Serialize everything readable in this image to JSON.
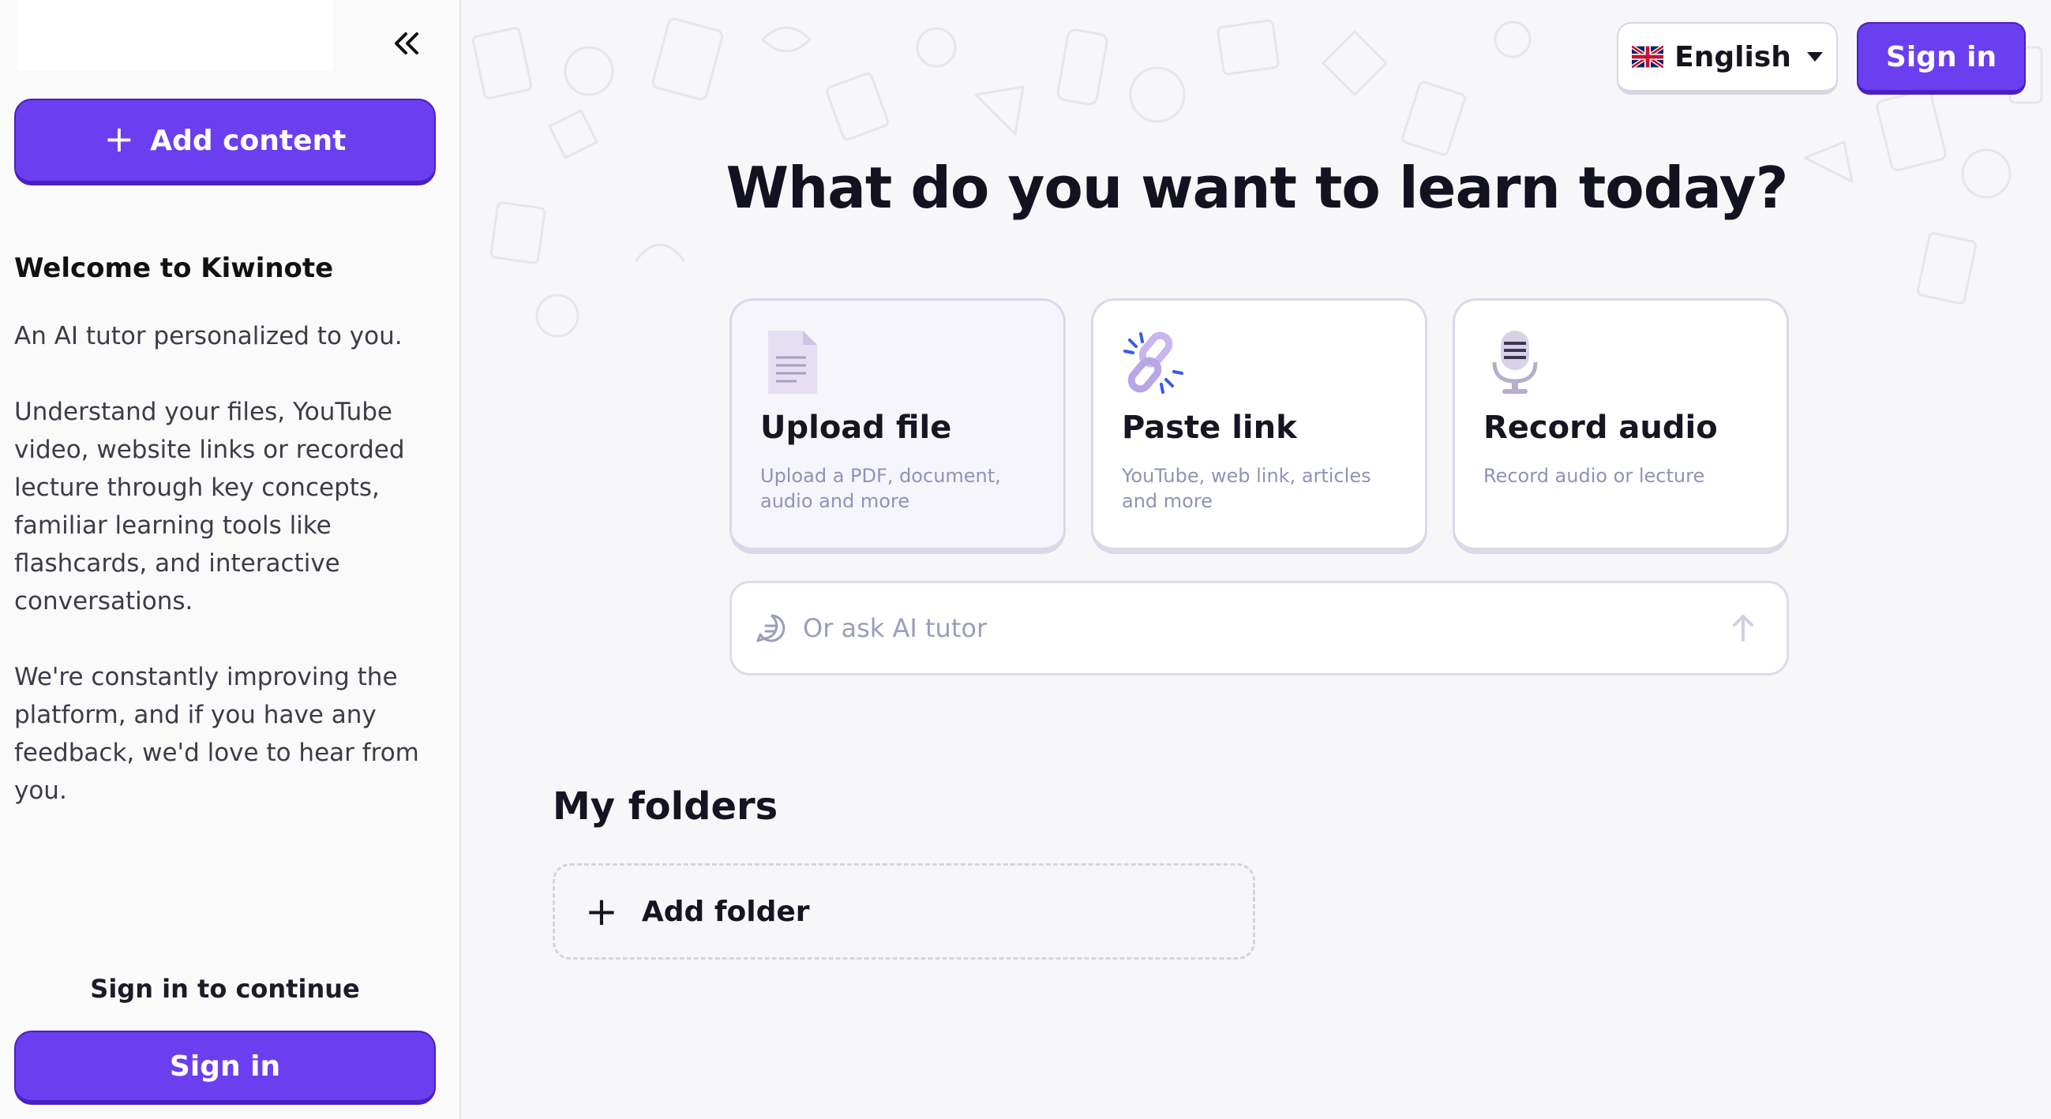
{
  "sidebar": {
    "add_content_label": "Add content",
    "welcome_title": "Welcome to Kiwinote",
    "welcome_paragraphs": [
      "An AI tutor personalized to you.",
      "Understand your files, YouTube video, website links or recorded lecture through key concepts, familiar learning tools like flashcards, and interactive conversations.",
      "We're constantly improving the platform, and if you have any feedback, we'd love to hear from you."
    ],
    "signin_prompt": "Sign in to continue",
    "signin_label": "Sign in"
  },
  "header": {
    "language": "English",
    "language_flag": "uk-flag-icon",
    "signin_label": "Sign in"
  },
  "main": {
    "headline": "What do you want to learn today?",
    "cards": [
      {
        "icon": "document-icon",
        "title": "Upload file",
        "description": "Upload a PDF, document, audio and more"
      },
      {
        "icon": "link-icon",
        "title": "Paste link",
        "description": "YouTube, web link, articles and more"
      },
      {
        "icon": "microphone-icon",
        "title": "Record audio",
        "description": "Record audio or lecture"
      }
    ],
    "ask_placeholder": "Or ask AI tutor",
    "folders_title": "My folders",
    "add_folder_label": "Add folder"
  },
  "colors": {
    "primary": "#6b3ff0",
    "primary_dark": "#4a1fc4",
    "muted_text": "#8f93b8",
    "card_border": "#d9d9e8"
  }
}
